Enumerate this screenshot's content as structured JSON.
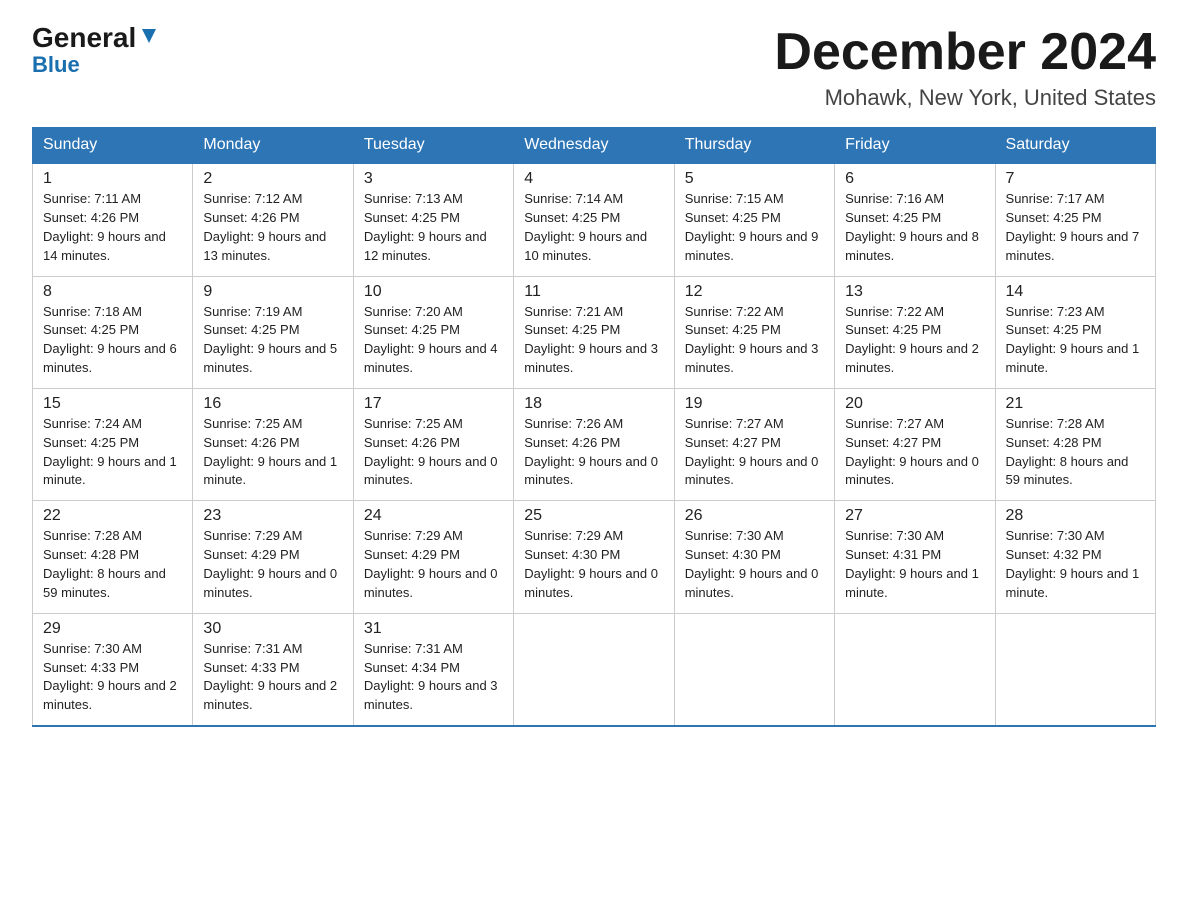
{
  "logo": {
    "general": "General",
    "blue": "Blue"
  },
  "title": "December 2024",
  "subtitle": "Mohawk, New York, United States",
  "days_of_week": [
    "Sunday",
    "Monday",
    "Tuesday",
    "Wednesday",
    "Thursday",
    "Friday",
    "Saturday"
  ],
  "weeks": [
    [
      {
        "day": "1",
        "sunrise": "7:11 AM",
        "sunset": "4:26 PM",
        "daylight": "9 hours and 14 minutes."
      },
      {
        "day": "2",
        "sunrise": "7:12 AM",
        "sunset": "4:26 PM",
        "daylight": "9 hours and 13 minutes."
      },
      {
        "day": "3",
        "sunrise": "7:13 AM",
        "sunset": "4:25 PM",
        "daylight": "9 hours and 12 minutes."
      },
      {
        "day": "4",
        "sunrise": "7:14 AM",
        "sunset": "4:25 PM",
        "daylight": "9 hours and 10 minutes."
      },
      {
        "day": "5",
        "sunrise": "7:15 AM",
        "sunset": "4:25 PM",
        "daylight": "9 hours and 9 minutes."
      },
      {
        "day": "6",
        "sunrise": "7:16 AM",
        "sunset": "4:25 PM",
        "daylight": "9 hours and 8 minutes."
      },
      {
        "day": "7",
        "sunrise": "7:17 AM",
        "sunset": "4:25 PM",
        "daylight": "9 hours and 7 minutes."
      }
    ],
    [
      {
        "day": "8",
        "sunrise": "7:18 AM",
        "sunset": "4:25 PM",
        "daylight": "9 hours and 6 minutes."
      },
      {
        "day": "9",
        "sunrise": "7:19 AM",
        "sunset": "4:25 PM",
        "daylight": "9 hours and 5 minutes."
      },
      {
        "day": "10",
        "sunrise": "7:20 AM",
        "sunset": "4:25 PM",
        "daylight": "9 hours and 4 minutes."
      },
      {
        "day": "11",
        "sunrise": "7:21 AM",
        "sunset": "4:25 PM",
        "daylight": "9 hours and 3 minutes."
      },
      {
        "day": "12",
        "sunrise": "7:22 AM",
        "sunset": "4:25 PM",
        "daylight": "9 hours and 3 minutes."
      },
      {
        "day": "13",
        "sunrise": "7:22 AM",
        "sunset": "4:25 PM",
        "daylight": "9 hours and 2 minutes."
      },
      {
        "day": "14",
        "sunrise": "7:23 AM",
        "sunset": "4:25 PM",
        "daylight": "9 hours and 1 minute."
      }
    ],
    [
      {
        "day": "15",
        "sunrise": "7:24 AM",
        "sunset": "4:25 PM",
        "daylight": "9 hours and 1 minute."
      },
      {
        "day": "16",
        "sunrise": "7:25 AM",
        "sunset": "4:26 PM",
        "daylight": "9 hours and 1 minute."
      },
      {
        "day": "17",
        "sunrise": "7:25 AM",
        "sunset": "4:26 PM",
        "daylight": "9 hours and 0 minutes."
      },
      {
        "day": "18",
        "sunrise": "7:26 AM",
        "sunset": "4:26 PM",
        "daylight": "9 hours and 0 minutes."
      },
      {
        "day": "19",
        "sunrise": "7:27 AM",
        "sunset": "4:27 PM",
        "daylight": "9 hours and 0 minutes."
      },
      {
        "day": "20",
        "sunrise": "7:27 AM",
        "sunset": "4:27 PM",
        "daylight": "9 hours and 0 minutes."
      },
      {
        "day": "21",
        "sunrise": "7:28 AM",
        "sunset": "4:28 PM",
        "daylight": "8 hours and 59 minutes."
      }
    ],
    [
      {
        "day": "22",
        "sunrise": "7:28 AM",
        "sunset": "4:28 PM",
        "daylight": "8 hours and 59 minutes."
      },
      {
        "day": "23",
        "sunrise": "7:29 AM",
        "sunset": "4:29 PM",
        "daylight": "9 hours and 0 minutes."
      },
      {
        "day": "24",
        "sunrise": "7:29 AM",
        "sunset": "4:29 PM",
        "daylight": "9 hours and 0 minutes."
      },
      {
        "day": "25",
        "sunrise": "7:29 AM",
        "sunset": "4:30 PM",
        "daylight": "9 hours and 0 minutes."
      },
      {
        "day": "26",
        "sunrise": "7:30 AM",
        "sunset": "4:30 PM",
        "daylight": "9 hours and 0 minutes."
      },
      {
        "day": "27",
        "sunrise": "7:30 AM",
        "sunset": "4:31 PM",
        "daylight": "9 hours and 1 minute."
      },
      {
        "day": "28",
        "sunrise": "7:30 AM",
        "sunset": "4:32 PM",
        "daylight": "9 hours and 1 minute."
      }
    ],
    [
      {
        "day": "29",
        "sunrise": "7:30 AM",
        "sunset": "4:33 PM",
        "daylight": "9 hours and 2 minutes."
      },
      {
        "day": "30",
        "sunrise": "7:31 AM",
        "sunset": "4:33 PM",
        "daylight": "9 hours and 2 minutes."
      },
      {
        "day": "31",
        "sunrise": "7:31 AM",
        "sunset": "4:34 PM",
        "daylight": "9 hours and 3 minutes."
      },
      null,
      null,
      null,
      null
    ]
  ]
}
